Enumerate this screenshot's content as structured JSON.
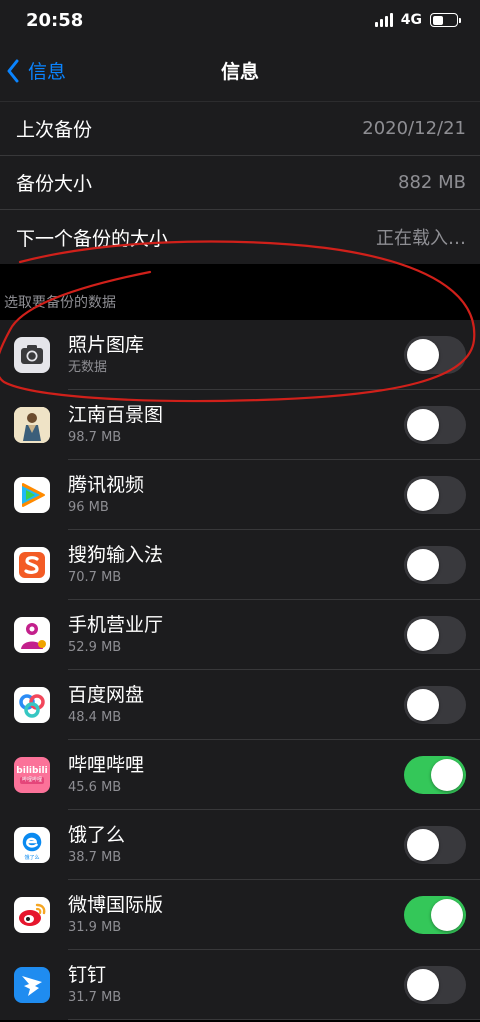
{
  "status": {
    "time": "20:58",
    "network": "4G"
  },
  "nav": {
    "back_label": "信息",
    "title": "信息"
  },
  "info": [
    {
      "label": "上次备份",
      "value": "2020/12/21"
    },
    {
      "label": "备份大小",
      "value": "882 MB"
    },
    {
      "label": "下一个备份的大小",
      "value": "正在载入…"
    }
  ],
  "section_header": "选取要备份的数据",
  "apps": [
    {
      "name": "照片图库",
      "size": "无数据",
      "on": false,
      "icon": "camera-icon"
    },
    {
      "name": "江南百景图",
      "size": "98.7 MB",
      "on": false,
      "icon": "jiangnan-app-icon"
    },
    {
      "name": "腾讯视频",
      "size": "96 MB",
      "on": false,
      "icon": "tencent-video-icon"
    },
    {
      "name": "搜狗输入法",
      "size": "70.7 MB",
      "on": false,
      "icon": "sogou-input-icon"
    },
    {
      "name": "手机营业厅",
      "size": "52.9 MB",
      "on": false,
      "icon": "unicom-app-icon"
    },
    {
      "name": "百度网盘",
      "size": "48.4 MB",
      "on": false,
      "icon": "baidu-netdisk-icon"
    },
    {
      "name": "哔哩哔哩",
      "size": "45.6 MB",
      "on": true,
      "icon": "bilibili-icon",
      "icon_text": "bilibili",
      "icon_subtext": "哔哩哔哩"
    },
    {
      "name": "饿了么",
      "size": "38.7 MB",
      "on": false,
      "icon": "eleme-icon",
      "icon_text": "饿了么"
    },
    {
      "name": "微博国际版",
      "size": "31.9 MB",
      "on": true,
      "icon": "weibo-icon"
    },
    {
      "name": "钉钉",
      "size": "31.7 MB",
      "on": false,
      "icon": "dingtalk-icon"
    }
  ],
  "colors": {
    "accent": "#0a84ff",
    "toggle_on": "#34c759",
    "toggle_off": "#39393d",
    "annotation": "#d0201a"
  }
}
